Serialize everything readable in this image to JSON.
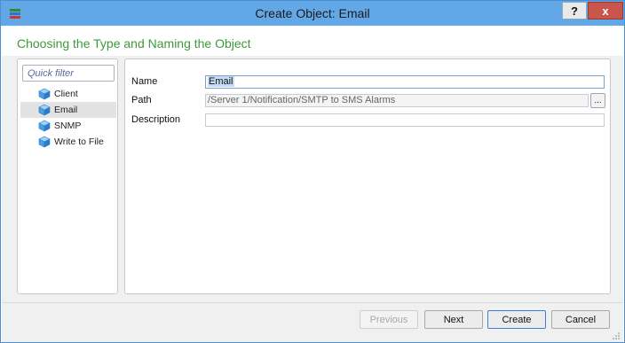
{
  "window": {
    "title": "Create Object: Email",
    "help_label": "?",
    "close_label": "x"
  },
  "header": {
    "heading": "Choosing the Type and Naming the Object"
  },
  "types": {
    "filter_placeholder": "Quick filter",
    "items": [
      {
        "label": "Client",
        "selected": false
      },
      {
        "label": "Email",
        "selected": true
      },
      {
        "label": "SNMP",
        "selected": false
      },
      {
        "label": "Write to File",
        "selected": false
      }
    ]
  },
  "form": {
    "name_label": "Name",
    "name_value": "Email",
    "path_label": "Path",
    "path_value": "/Server 1/Notification/SMTP to SMS Alarms",
    "browse_label": "...",
    "description_label": "Description",
    "description_value": ""
  },
  "footer": {
    "previous_label": "Previous",
    "next_label": "Next",
    "create_label": "Create",
    "cancel_label": "Cancel"
  },
  "colors": {
    "titlebar": "#62a8e6",
    "heading": "#3c9a3a",
    "close_button": "#c7564c"
  }
}
